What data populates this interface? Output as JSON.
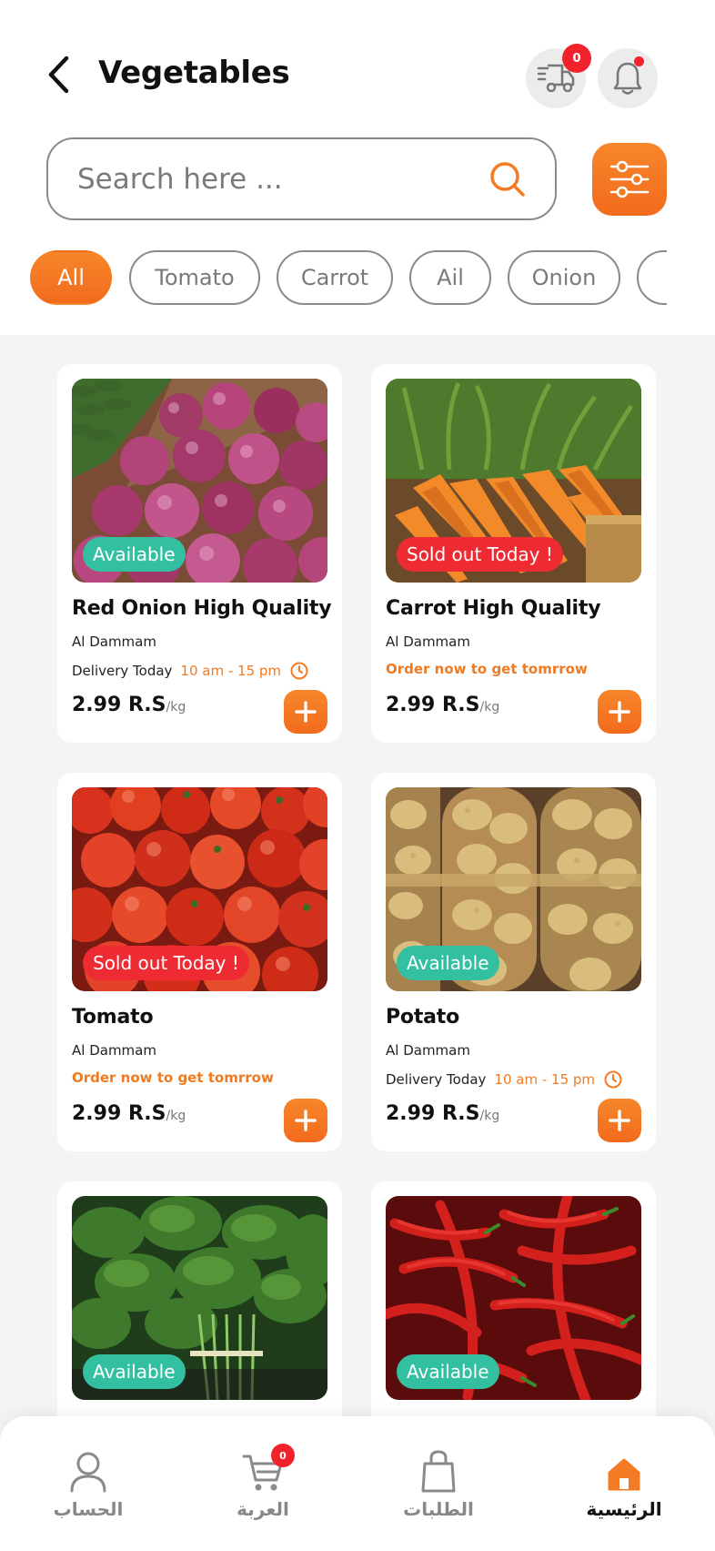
{
  "header": {
    "title": "Vegetables",
    "cart_count": "0"
  },
  "search": {
    "placeholder": "Search here ..."
  },
  "chips": [
    {
      "label": "All",
      "active": true
    },
    {
      "label": "Tomato",
      "active": false
    },
    {
      "label": "Carrot",
      "active": false
    },
    {
      "label": "Ail",
      "active": false
    },
    {
      "label": "Onion",
      "active": false
    },
    {
      "label": "",
      "active": false
    }
  ],
  "products": [
    {
      "name": "Red Onion High Quality",
      "location": "Al Dammam",
      "status": "Available",
      "delivery_label": "Delivery Today",
      "delivery_time": "10 am - 15 pm",
      "order_note": "",
      "price": "2.99 R.S",
      "unit": "/kg",
      "image": "red-onions"
    },
    {
      "name": "Carrot High Quality",
      "location": "Al Dammam",
      "status": "Sold out Today !",
      "delivery_label": "",
      "delivery_time": "",
      "order_note": "Order now to get tomrrow",
      "price": "2.99 R.S",
      "unit": "/kg",
      "image": "carrots"
    },
    {
      "name": "Tomato",
      "location": "Al Dammam",
      "status": "Sold out Today !",
      "delivery_label": "",
      "delivery_time": "",
      "order_note": "Order now to get tomrrow",
      "price": "2.99 R.S",
      "unit": "/kg",
      "image": "tomatoes"
    },
    {
      "name": "Potato",
      "location": "Al Dammam",
      "status": "Available",
      "delivery_label": "Delivery Today",
      "delivery_time": "10 am - 15 pm",
      "order_note": "",
      "price": "2.99 R.S",
      "unit": "/kg",
      "image": "potatoes"
    },
    {
      "name": "",
      "location": "",
      "status": "Available",
      "delivery_label": "",
      "delivery_time": "",
      "order_note": "",
      "price": "",
      "unit": "",
      "image": "spinach"
    },
    {
      "name": "",
      "location": "",
      "status": "Available",
      "delivery_label": "",
      "delivery_time": "",
      "order_note": "",
      "price": "",
      "unit": "",
      "image": "red-chili-peppers"
    }
  ],
  "bottom_nav": {
    "account": "الحساب",
    "cart": "العربة",
    "cart_count": "0",
    "orders": "الطلبات",
    "home": "الرئيسية"
  },
  "colors": {
    "accent": "#f47a24",
    "available": "#33c0a1",
    "sold_out": "#ee2a33"
  }
}
